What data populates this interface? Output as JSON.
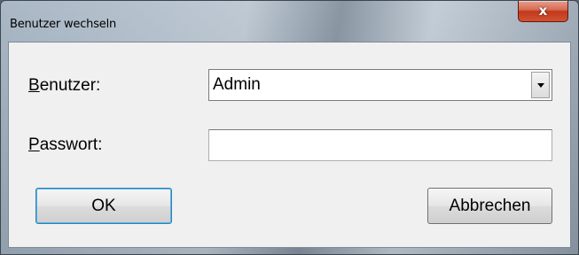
{
  "window": {
    "title": "Benutzer wechseln",
    "close_glyph": "x"
  },
  "form": {
    "user_label_accel": "B",
    "user_label_rest": "enutzer:",
    "user_value": "Admin",
    "password_label_accel": "P",
    "password_label_rest": "asswort:",
    "password_value": ""
  },
  "buttons": {
    "ok_label": "OK",
    "cancel_label": "Abbrechen"
  },
  "icons": {
    "close": "close-icon",
    "dropdown": "chevron-down-icon"
  },
  "colors": {
    "close_button": "#c3381b",
    "client_background": "#f0f0f0",
    "default_button_border": "#3c7fb1"
  }
}
